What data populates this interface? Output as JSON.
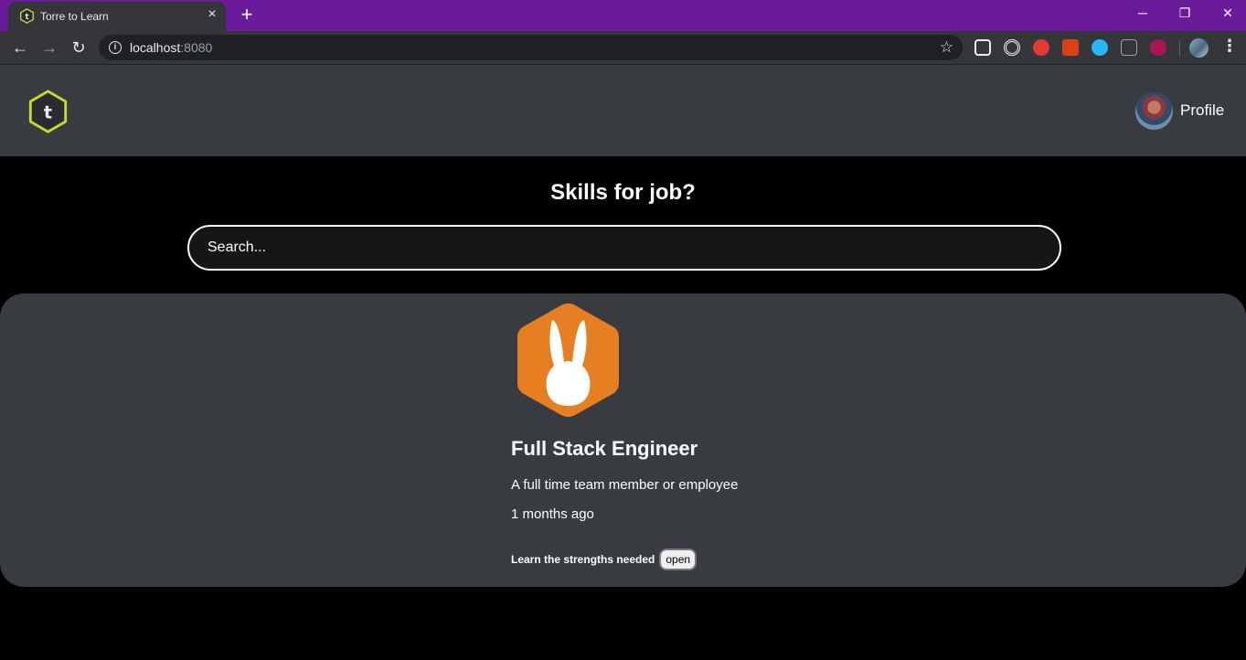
{
  "browser": {
    "tab_title": "Torre to Learn",
    "tab_close_icon": "close-icon",
    "new_tab_icon": "plus-icon",
    "url_host": "localhost",
    "url_port": ":8080",
    "colors": {
      "tabbar": "#6a1b9a",
      "toolbar": "#35363a"
    }
  },
  "header": {
    "logo_letter": "t",
    "profile_label": "Profile"
  },
  "main": {
    "headline": "Skills for job?",
    "search_placeholder": "Search..."
  },
  "job": {
    "title": "Full Stack Engineer",
    "type": "A full time team member or employee",
    "posted": "1 months ago",
    "learn_label": "Learn the strengths needed",
    "open_button": "open",
    "logo_color": "#e67e22"
  }
}
